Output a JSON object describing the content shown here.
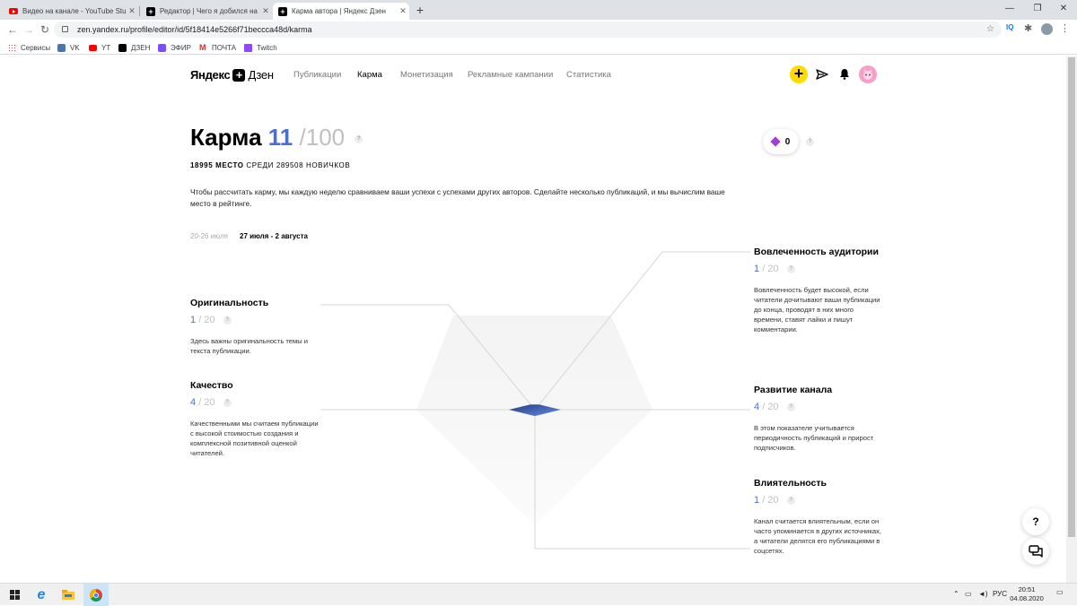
{
  "browser": {
    "tabs": [
      {
        "title": "Видео на канале - YouTube Stud",
        "icon": "youtube-icon",
        "active": false
      },
      {
        "title": "Редактор | Чего я добился на д",
        "icon": "dzen-icon",
        "active": false
      },
      {
        "title": "Карма автора | Яндекс Дзен",
        "icon": "dzen-icon",
        "active": true
      }
    ],
    "new_tab": "+",
    "url": "zen.yandex.ru/profile/editor/id/5f18414e5266f71beccca48d/karma",
    "bookmarks": [
      "Сервисы",
      "VK",
      "YT",
      "ДЗЕН",
      "ЭФИР",
      "ПОЧТА",
      "Twitch"
    ],
    "iq_label": "IQ"
  },
  "header": {
    "logo_part1": "Яндекс",
    "logo_plus": "+",
    "logo_part2": "Дзен",
    "nav": [
      "Публикации",
      "Карма",
      "Монетизация",
      "Рекламные кампании",
      "Статистика"
    ],
    "active_nav": "Карма",
    "add_label": "+"
  },
  "karma": {
    "title": "Карма",
    "value": "11",
    "max": "/100",
    "help": "?",
    "rank_place": "18995 МЕСТО",
    "rank_rest": "СРЕДИ 289508 НОВИЧКОВ",
    "intro": "Чтобы рассчитать карму, мы каждую неделю сравниваем ваши успехи с успехами других авторов. Сделайте несколько публикаций, и мы вычислим ваше место в рейтинге.",
    "week_prev": "20-26 июля",
    "week_current": "27 июля - 2 августа",
    "gems": "0"
  },
  "metrics": {
    "originality": {
      "title": "Оригинальность",
      "score": "1",
      "max": "/ 20",
      "value": 1,
      "desc": "Здесь важны оригинальность темы и текста публикации."
    },
    "quality": {
      "title": "Качество",
      "score": "4",
      "max": "/ 20",
      "value": 4,
      "desc": "Качественными мы считаем публикации с высокой стоимостью создания и комплексной позитивной оценкой читателей."
    },
    "engagement": {
      "title": "Вовлеченность аудитории",
      "score": "1",
      "max": "/ 20",
      "value": 1,
      "desc": "Вовлеченность будет высокой, если читатели дочитывают ваши публикации до конца, проводят в них много времени, ставят лайки и пишут комментарии."
    },
    "growth": {
      "title": "Развитие канала",
      "score": "4",
      "max": "/ 20",
      "value": 4,
      "desc": "В этом показателе учитывается периодичность публикаций и прирост подписчиков."
    },
    "influence": {
      "title": "Влиятельность",
      "score": "1",
      "max": "/ 20",
      "value": 1,
      "desc": "Канал считается влиятельным, если он часто упоминается в других источниках, а читатели делятся его публикациями в соцсетях."
    }
  },
  "widgets": {
    "help": "?"
  },
  "taskbar": {
    "lang": "РУС",
    "time": "20:51",
    "date": "04.08.2020"
  }
}
